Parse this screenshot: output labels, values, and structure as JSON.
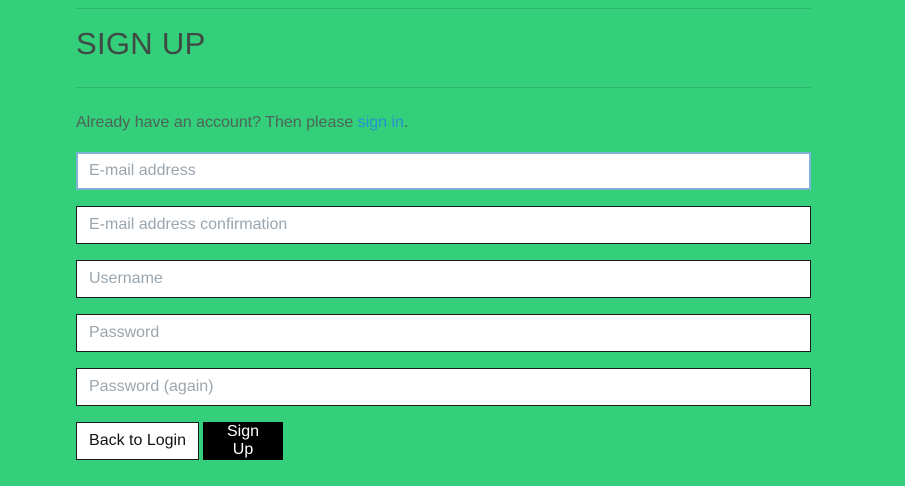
{
  "page": {
    "title": "SIGN UP"
  },
  "intro": {
    "text": "Already have an account? Then please ",
    "link": "sign in",
    "suffix": "."
  },
  "form": {
    "email_placeholder": "E-mail address",
    "email_confirm_placeholder": "E-mail address confirmation",
    "username_placeholder": "Username",
    "password_placeholder": "Password",
    "password_again_placeholder": "Password (again)"
  },
  "actions": {
    "back_label": "Back to Login",
    "signup_label": "Sign Up"
  },
  "colors": {
    "background": "#33cf7a",
    "link": "#2a8fd4",
    "primary_button": "#000000"
  }
}
